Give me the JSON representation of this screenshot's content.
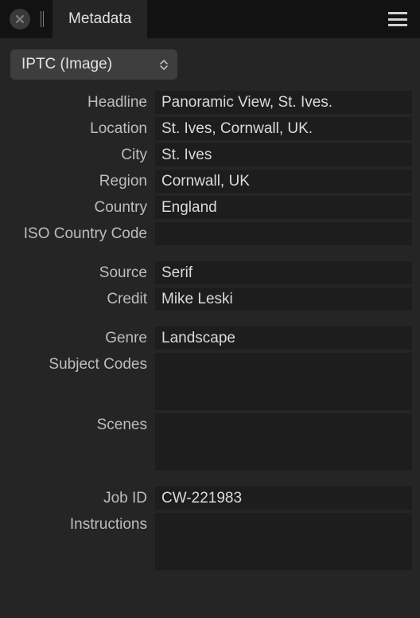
{
  "tab": {
    "title": "Metadata"
  },
  "dropdown": {
    "selected": "IPTC (Image)"
  },
  "fields": {
    "headline": {
      "label": "Headline",
      "value": "Panoramic View, St. Ives."
    },
    "location": {
      "label": "Location",
      "value": "St. Ives, Cornwall, UK."
    },
    "city": {
      "label": "City",
      "value": "St. Ives"
    },
    "region": {
      "label": "Region",
      "value": "Cornwall, UK"
    },
    "country": {
      "label": "Country",
      "value": "England"
    },
    "iso_country_code": {
      "label": "ISO Country Code",
      "value": ""
    },
    "source": {
      "label": "Source",
      "value": "Serif"
    },
    "credit": {
      "label": "Credit",
      "value": "Mike Leski"
    },
    "genre": {
      "label": "Genre",
      "value": "Landscape"
    },
    "subject_codes": {
      "label": "Subject Codes",
      "value": ""
    },
    "scenes": {
      "label": "Scenes",
      "value": ""
    },
    "job_id": {
      "label": "Job ID",
      "value": "CW-221983"
    },
    "instructions": {
      "label": "Instructions",
      "value": ""
    }
  }
}
